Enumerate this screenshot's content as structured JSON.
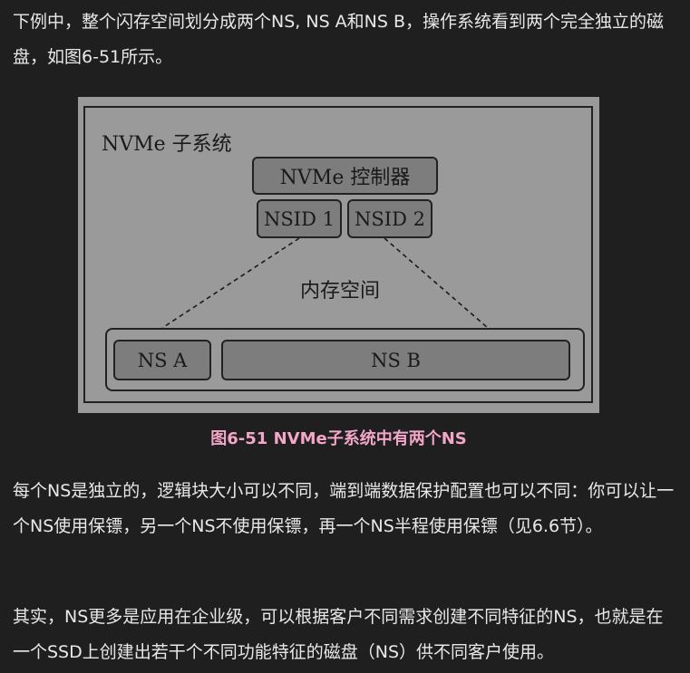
{
  "intro_text": "下例中，整个闪存空间划分成两个NS, NS A和NS B，操作系统看到两个完全独立的磁盘，如图6-51所示。",
  "figure": {
    "subsystem_label": "NVMe 子系统",
    "controller_label": "NVMe 控制器",
    "nsid1_label": "NSID 1",
    "nsid2_label": "NSID 2",
    "memory_label": "内存空间",
    "ns_a_label": "NS A",
    "ns_b_label": "NS B",
    "caption": "图6-51 NVMe子系统中有两个NS"
  },
  "para2_text": "每个NS是独立的，逻辑块大小可以不同，端到端数据保护配置也可以不同：你可以让一个NS使用保镖，另一个NS不使用保镖，再一个NS半程使用保镖（见6.6节）。",
  "para3_text": "其实，NS更多是应用在企业级，可以根据客户不同需求创建不同特征的NS，也就是在一个SSD上创建出若干个不同功能特征的磁盘（NS）供不同客户使用。"
}
